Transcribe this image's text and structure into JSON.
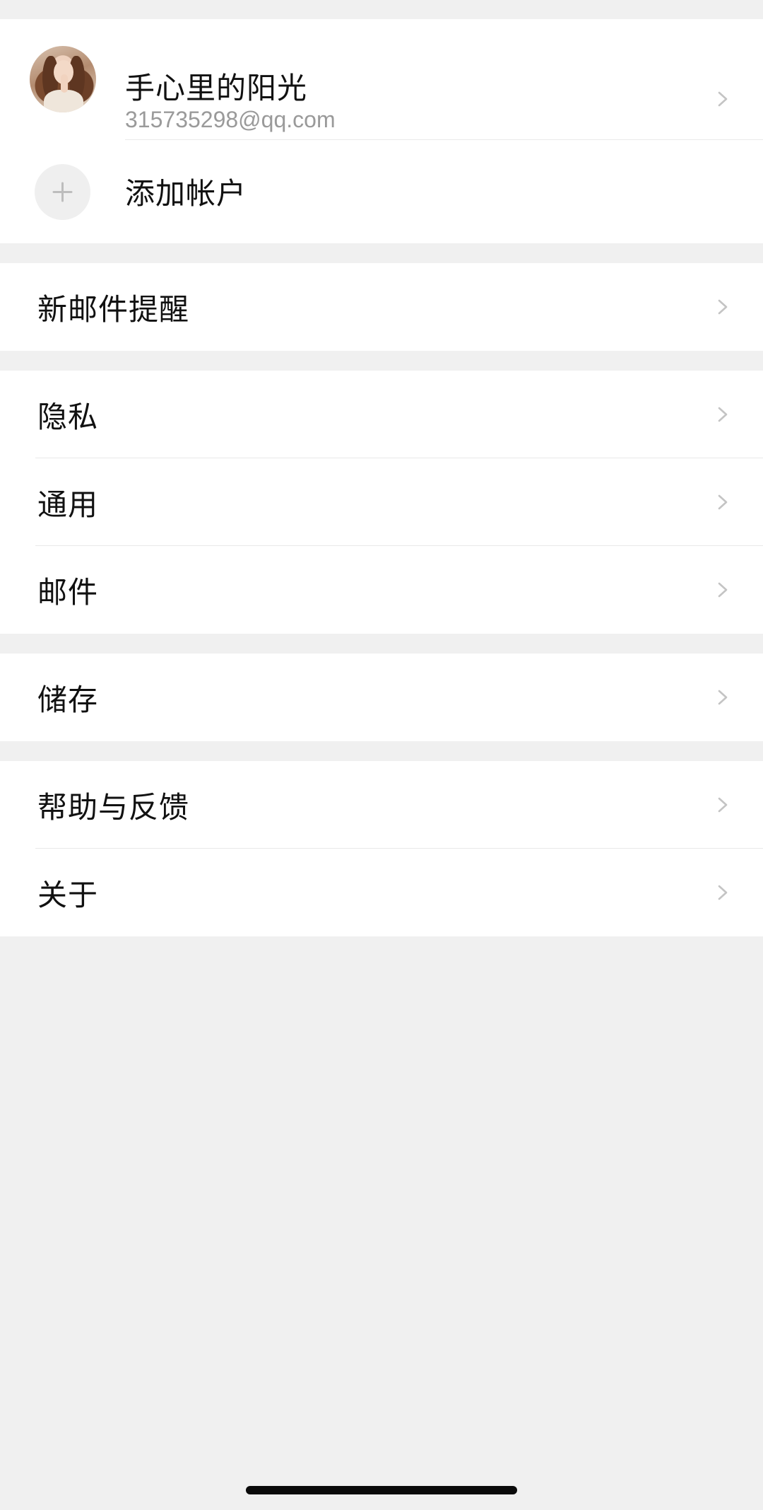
{
  "account": {
    "name": "手心里的阳光",
    "email": "315735298@qq.com",
    "avatar_icon": "user-avatar"
  },
  "add_account": {
    "label": "添加帐户",
    "icon": "plus-icon"
  },
  "settings": {
    "new_mail_alert": "新邮件提醒",
    "privacy": "隐私",
    "general": "通用",
    "mail": "邮件",
    "storage": "储存",
    "help_feedback": "帮助与反馈",
    "about": "关于"
  },
  "colors": {
    "background": "#f0f0f0",
    "card": "#ffffff",
    "primary_text": "#111111",
    "secondary_text": "#9a9a9a",
    "chevron": "#c4c4c4",
    "divider": "#e9e9e9"
  }
}
